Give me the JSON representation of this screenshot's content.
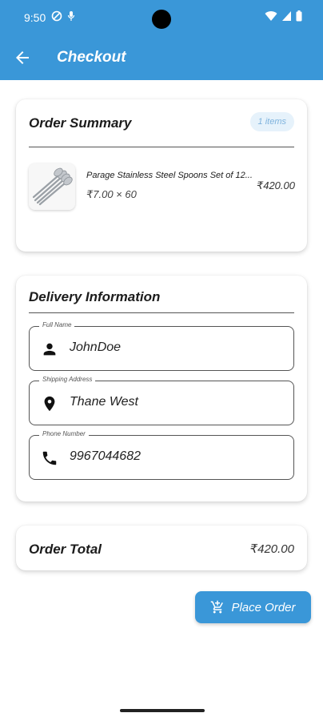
{
  "status": {
    "time": "9:50"
  },
  "appbar": {
    "title": "Checkout",
    "back_icon": "arrow-back-icon"
  },
  "order_summary": {
    "title": "Order Summary",
    "items_badge": "1 items",
    "item": {
      "name": "Parage Stainless Steel Spoons Set of 12...",
      "qty_line": "₹7.00 × 60",
      "price": "₹420.00"
    }
  },
  "delivery": {
    "title": "Delivery Information",
    "full_name": {
      "label": "Full Name",
      "value": "JohnDoe",
      "icon": "person-icon"
    },
    "address": {
      "label": "Shipping Address",
      "value": "Thane West",
      "icon": "location-pin-icon"
    },
    "phone": {
      "label": "Phone Number",
      "value": "9967044682",
      "icon": "phone-icon"
    }
  },
  "total": {
    "label": "Order Total",
    "value": "₹420.00"
  },
  "place_order": {
    "label": "Place Order",
    "icon": "cart-add-icon"
  },
  "colors": {
    "primary": "#3a97d8",
    "badge_bg": "#e6f2fb",
    "badge_text": "#7fb3dd"
  }
}
